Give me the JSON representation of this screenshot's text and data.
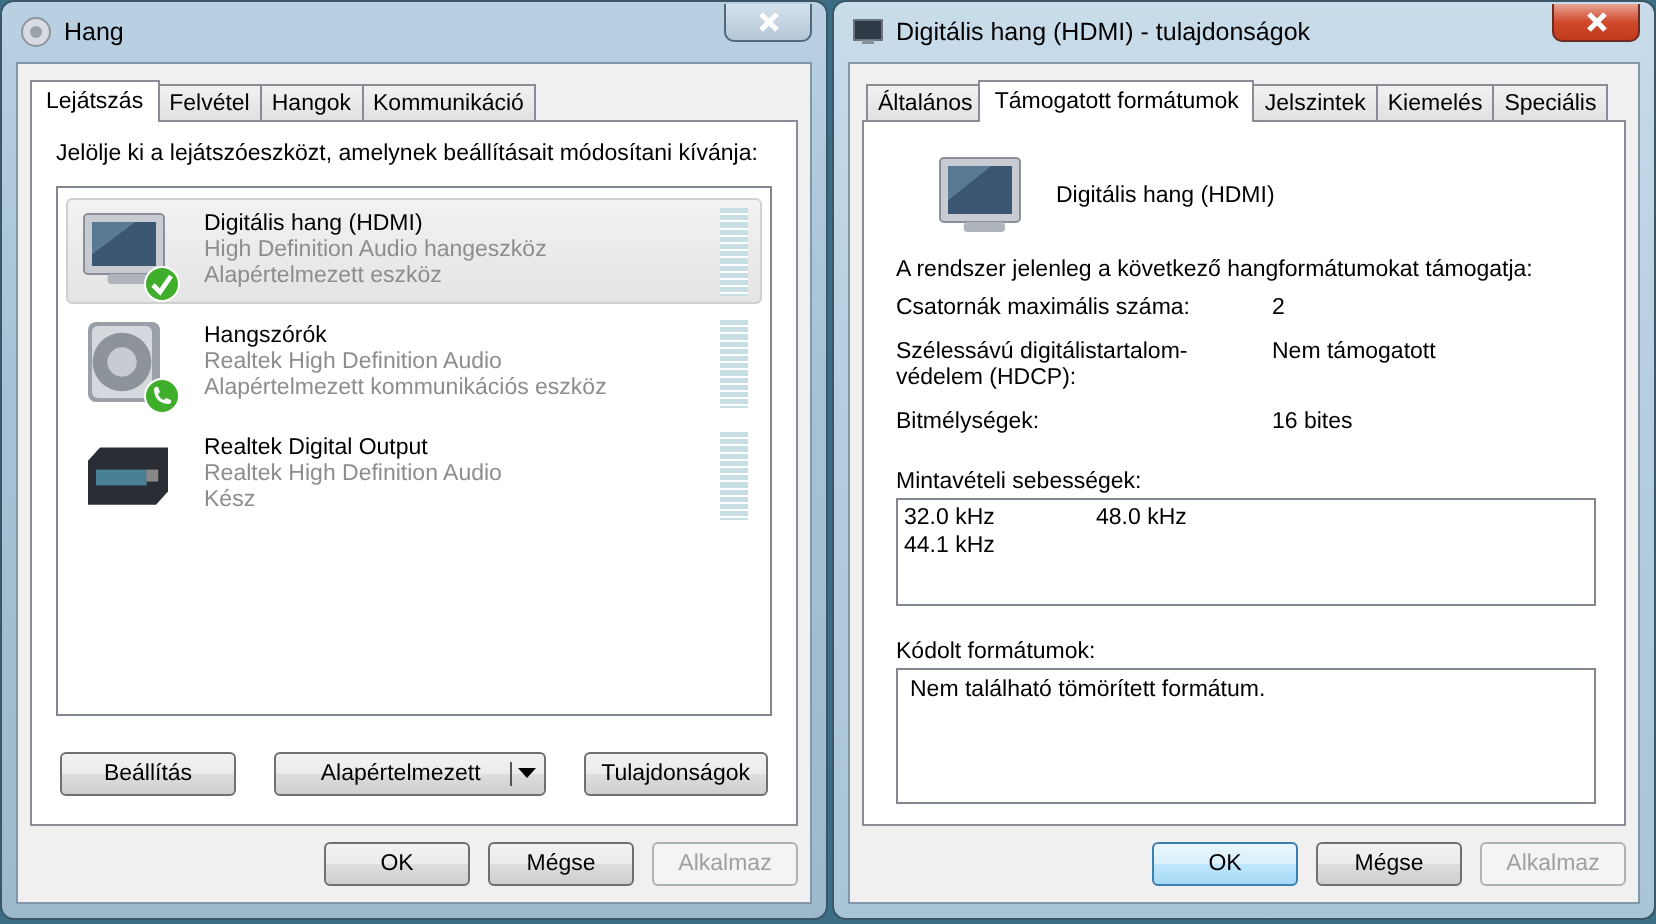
{
  "sound_dialog": {
    "title": "Hang",
    "active": false,
    "tabs": [
      {
        "label": "Lejátszás",
        "selected": true
      },
      {
        "label": "Felvétel",
        "selected": false
      },
      {
        "label": "Hangok",
        "selected": false
      },
      {
        "label": "Kommunikáció",
        "selected": false
      }
    ],
    "instruction": "Jelölje ki a lejátszóeszközt, amelynek beállításait módosítani kívánja:",
    "devices": [
      {
        "kind": "monitor",
        "default_device": true,
        "default_communication": false,
        "name": "Digitális hang (HDMI)",
        "driver": "High Definition Audio hangeszköz",
        "status": "Alapértelmezett eszköz",
        "selected": true
      },
      {
        "kind": "speaker",
        "default_device": false,
        "default_communication": true,
        "name": "Hangszórók",
        "driver": "Realtek High Definition Audio",
        "status": "Alapértelmezett kommunikációs eszköz",
        "selected": false
      },
      {
        "kind": "receiver",
        "default_device": false,
        "default_communication": false,
        "name": "Realtek Digital Output",
        "driver": "Realtek High Definition Audio",
        "status": "Kész",
        "selected": false
      }
    ],
    "device_buttons": [
      {
        "kind": "plain",
        "label": "Beállítás"
      },
      {
        "kind": "split",
        "label": "Alapértelmezett"
      },
      {
        "kind": "plain",
        "label": "Tulajdonságok"
      }
    ],
    "footer_buttons": [
      {
        "label": "OK",
        "disabled": false,
        "default": false
      },
      {
        "label": "Mégse",
        "disabled": false,
        "default": false
      },
      {
        "label": "Alkalmaz",
        "disabled": true,
        "default": false
      }
    ]
  },
  "properties_dialog": {
    "title": "Digitális hang (HDMI) - tulajdonságok",
    "active": true,
    "tabs": [
      {
        "label": "Általános",
        "selected": false
      },
      {
        "label": "Támogatott formátumok",
        "selected": true
      },
      {
        "label": "Jelszintek",
        "selected": false
      },
      {
        "label": "Kiemelés",
        "selected": false
      },
      {
        "label": "Speciális",
        "selected": false
      }
    ],
    "device_name": "Digitális hang (HDMI)",
    "intro": "A rendszer jelenleg a következő hangformátumokat támogatja:",
    "properties": [
      {
        "label": "Csatornák maximális száma:",
        "value": "2"
      },
      {
        "label": "Szélessávú digitálistartalom-védelem (HDCP):",
        "value": "Nem támogatott"
      },
      {
        "label": "Bitmélységek:",
        "value": "16 bites"
      }
    ],
    "sample_rates_label": "Mintavételi sebességek:",
    "sample_rates": [
      "32.0 kHz",
      "44.1 kHz",
      "48.0 kHz"
    ],
    "encoded_label": "Kódolt formátumok:",
    "encoded_formats": [
      "Nem található tömörített formátum."
    ],
    "footer_buttons": [
      {
        "label": "OK",
        "disabled": false,
        "default": true
      },
      {
        "label": "Mégse",
        "disabled": false,
        "default": false
      },
      {
        "label": "Alkalmaz",
        "disabled": true,
        "default": false
      }
    ]
  }
}
